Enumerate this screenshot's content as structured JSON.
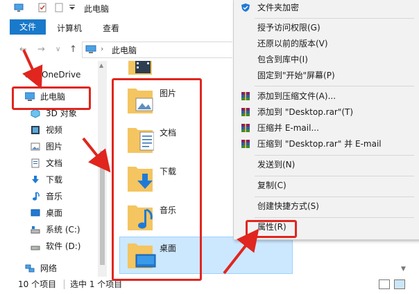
{
  "window": {
    "title": "此电脑"
  },
  "ribbon": {
    "tabs": [
      "文件",
      "计算机",
      "查看"
    ]
  },
  "address": {
    "path": "此电脑"
  },
  "sidebar": {
    "items": [
      {
        "label": "OneDrive",
        "icon": "onedrive-icon"
      },
      {
        "label": "此电脑",
        "icon": "computer-icon"
      },
      {
        "label": "3D 对象",
        "icon": "3d-objects-icon"
      },
      {
        "label": "视频",
        "icon": "video-icon"
      },
      {
        "label": "图片",
        "icon": "pictures-icon"
      },
      {
        "label": "文档",
        "icon": "documents-icon"
      },
      {
        "label": "下载",
        "icon": "downloads-icon"
      },
      {
        "label": "音乐",
        "icon": "music-icon"
      },
      {
        "label": "桌面",
        "icon": "desktop-icon"
      },
      {
        "label": "系统 (C:)",
        "icon": "drive-c-icon"
      },
      {
        "label": "软件 (D:)",
        "icon": "drive-d-icon"
      },
      {
        "label": "网络",
        "icon": "network-icon"
      }
    ]
  },
  "folders": [
    {
      "label": "图片",
      "icon": "pictures-folder-icon"
    },
    {
      "label": "文档",
      "icon": "documents-folder-icon"
    },
    {
      "label": "下载",
      "icon": "downloads-folder-icon"
    },
    {
      "label": "音乐",
      "icon": "music-folder-icon"
    },
    {
      "label": "桌面",
      "icon": "desktop-folder-icon"
    }
  ],
  "status": {
    "count": "10 个项目",
    "selected": "选中 1 个项目"
  },
  "context_menu": {
    "items": [
      {
        "label": "文件夹加密",
        "icon": "shield-icon"
      },
      {
        "label": "授予访问权限(G)"
      },
      {
        "label": "还原以前的版本(V)"
      },
      {
        "label": "包含到库中(I)"
      },
      {
        "label": "固定到\"开始\"屏幕(P)"
      },
      {
        "label": "添加到压缩文件(A)...",
        "icon": "winrar-icon"
      },
      {
        "label": "添加到 \"Desktop.rar\"(T)",
        "icon": "winrar-icon"
      },
      {
        "label": "压缩并 E-mail...",
        "icon": "winrar-icon"
      },
      {
        "label": "压缩到 \"Desktop.rar\" 并 E-mail",
        "icon": "winrar-icon"
      },
      {
        "label": "发送到(N)"
      },
      {
        "label": "复制(C)"
      },
      {
        "label": "创建快捷方式(S)"
      },
      {
        "label": "属性(R)"
      }
    ]
  },
  "colors": {
    "accent": "#1979ca",
    "annotation": "#e0261e",
    "selection": "#cce8ff",
    "folder": "#f4c560"
  }
}
